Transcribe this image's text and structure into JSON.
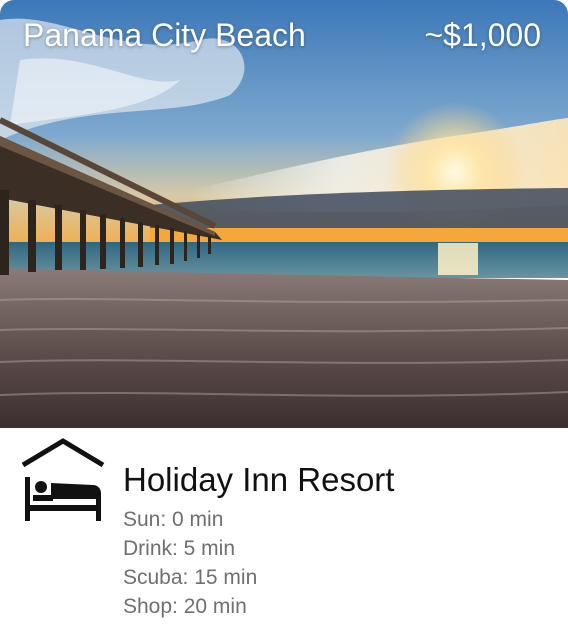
{
  "destination": {
    "name": "Panama City Beach",
    "price": "~$1,000"
  },
  "hotel": {
    "icon": "hotel-bed-icon",
    "name": "Holiday Inn Resort",
    "distances": [
      "Sun: 0 min",
      "Drink: 5 min",
      "Scuba: 15 min",
      "Shop: 20 min"
    ]
  },
  "colors": {
    "sky": "#4b83bd",
    "sunset": "#f5a73a",
    "sea": "#3e6f84",
    "sand": "#6e5b58",
    "text_primary": "#111111",
    "text_secondary": "#6f6f6f"
  }
}
